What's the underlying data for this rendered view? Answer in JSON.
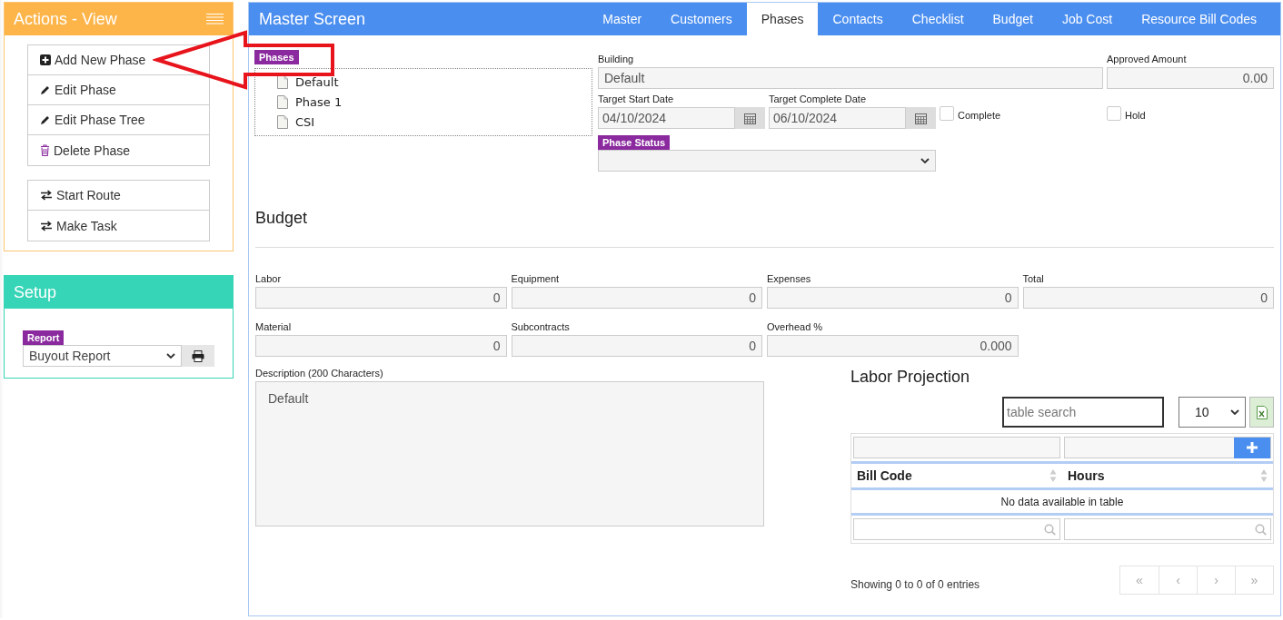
{
  "actions_panel": {
    "title": "Actions - View",
    "groups": [
      [
        {
          "label": "Add New Phase",
          "kind": "add"
        },
        {
          "label": "Edit Phase",
          "kind": "edit"
        },
        {
          "label": "Edit Phase Tree",
          "kind": "edit"
        },
        {
          "label": "Delete Phase",
          "kind": "delete"
        }
      ],
      [
        {
          "label": "Start Route",
          "kind": "route"
        },
        {
          "label": "Make Task",
          "kind": "route"
        }
      ]
    ]
  },
  "setup_panel": {
    "title": "Setup",
    "report_label": "Report",
    "report_value": "Buyout Report"
  },
  "master": {
    "title": "Master Screen",
    "tabs": [
      {
        "label": "Master",
        "selected": false
      },
      {
        "label": "Customers",
        "selected": false
      },
      {
        "label": "Phases",
        "selected": true
      },
      {
        "label": "Contacts",
        "selected": false
      },
      {
        "label": "Checklist",
        "selected": false
      },
      {
        "label": "Budget",
        "selected": false
      },
      {
        "label": "Job Cost",
        "selected": false
      },
      {
        "label": "Resource Bill Codes",
        "selected": false
      }
    ]
  },
  "phases_tree": {
    "label": "Phases",
    "items": [
      "Default",
      "Phase 1",
      "CSI"
    ]
  },
  "building": {
    "label": "Building",
    "value": "Default"
  },
  "approved_amount": {
    "label": "Approved Amount",
    "value": "0.00"
  },
  "target_start": {
    "label": "Target Start Date",
    "value": "04/10/2024"
  },
  "target_complete": {
    "label": "Target Complete Date",
    "value": "06/10/2024"
  },
  "complete": {
    "label": "Complete",
    "checked": false
  },
  "hold": {
    "label": "Hold",
    "checked": false
  },
  "phase_status": {
    "label": "Phase Status"
  },
  "budget": {
    "title": "Budget",
    "fields": [
      {
        "label": "Labor",
        "value": "0"
      },
      {
        "label": "Equipment",
        "value": "0"
      },
      {
        "label": "Expenses",
        "value": "0"
      },
      {
        "label": "Total",
        "value": "0"
      },
      {
        "label": "Material",
        "value": "0"
      },
      {
        "label": "Subcontracts",
        "value": "0"
      },
      {
        "label": "Overhead %",
        "value": "0.000"
      }
    ]
  },
  "description": {
    "label": "Description (200 Characters)",
    "value": "Default"
  },
  "labor_projection": {
    "title": "Labor Projection",
    "search_placeholder": "table search",
    "page_size": "10",
    "columns": [
      "Bill Code",
      "Hours"
    ],
    "empty_text": "No data available in table",
    "info": "Showing 0 to 0 of 0 entries",
    "pager": [
      "«",
      "‹",
      "›",
      "»"
    ]
  }
}
